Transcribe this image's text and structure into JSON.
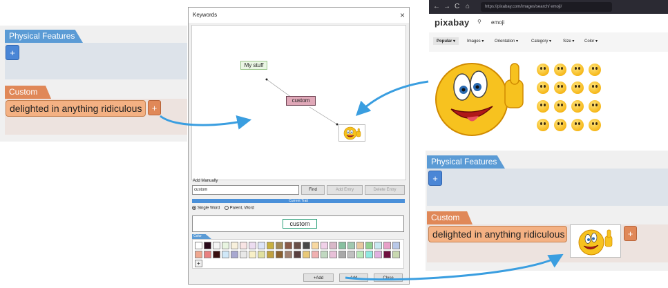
{
  "left_panel": {
    "physical_features_label": "Physical Features",
    "plus_label": "+",
    "custom_label": "Custom",
    "trait_chip": "delighted in anything ridiculous",
    "add_label": "+"
  },
  "dialog": {
    "title": "Keywords",
    "close_label": "×",
    "node_root": "My stuff",
    "node_custom": "custom",
    "add_manually_label": "Add Manually",
    "add_manually_value": "custom",
    "find_label": "Find",
    "add_entry_label": "Add Entry",
    "delete_entry_label": "Delete Entry",
    "current_trait_label": "Current Trait",
    "radio_single": "Single Word",
    "radio_parent": "Parent, Word",
    "preview_word": "custom",
    "color_label": "Color",
    "more_colors_label": "+",
    "btn_plus_add": "+Add",
    "btn_add": "Add",
    "btn_close": "Close",
    "colors": [
      "#ffffff",
      "#2a0a1a",
      "#f5f5f5",
      "#e8f4e0",
      "#f8f0dc",
      "#f8e4e4",
      "#ecdcf0",
      "#dce4f8",
      "#c8b040",
      "#a08858",
      "#8a5a48",
      "#6a5048",
      "#484848",
      "#f8d8a0",
      "#f0d0e8",
      "#d8b8c8",
      "#88c0a0",
      "#a0c8b0",
      "#e8c8a0",
      "#90d090",
      "#c8e8f0",
      "#e8a0c8",
      "#b8c8e8",
      "#f0a890",
      "#e88080",
      "#3a1010",
      "#d0e8f8",
      "#a8a8d0",
      "#e8e8e8",
      "#f8f0c8",
      "#e0e0a0",
      "#c0a040",
      "#8a6030",
      "#a08070",
      "#5a4040",
      "#e8c878",
      "#f0b0b0",
      "#c0d8c0",
      "#e8c0d8",
      "#a8a8a8",
      "#c0c0c0",
      "#b8e8b8",
      "#90e8e0",
      "#e0b0e0",
      "#701040",
      "#c8d8b0"
    ]
  },
  "browser": {
    "nav_back": "←",
    "nav_forward": "→",
    "nav_reload": "C",
    "nav_home": "⌂",
    "url": "https://pixabay.com/images/search/ emoji/",
    "logo": "pixabay",
    "search_value": "emoji",
    "filters": [
      "Popular ▾",
      "Images ▾",
      "Orientation ▾",
      "Category ▾",
      "Size ▾",
      "Color ▾"
    ]
  },
  "right_panel": {
    "physical_features_label": "Physical Features",
    "plus_label": "+",
    "custom_label": "Custom",
    "trait_chip": "delighted in anything ridiculous",
    "add_label": "+"
  },
  "colors": {
    "blue_tab": "#5b9bd5",
    "orange_tab": "#e08858",
    "arrow": "#3a9ee0",
    "chip": "#f4b183"
  }
}
